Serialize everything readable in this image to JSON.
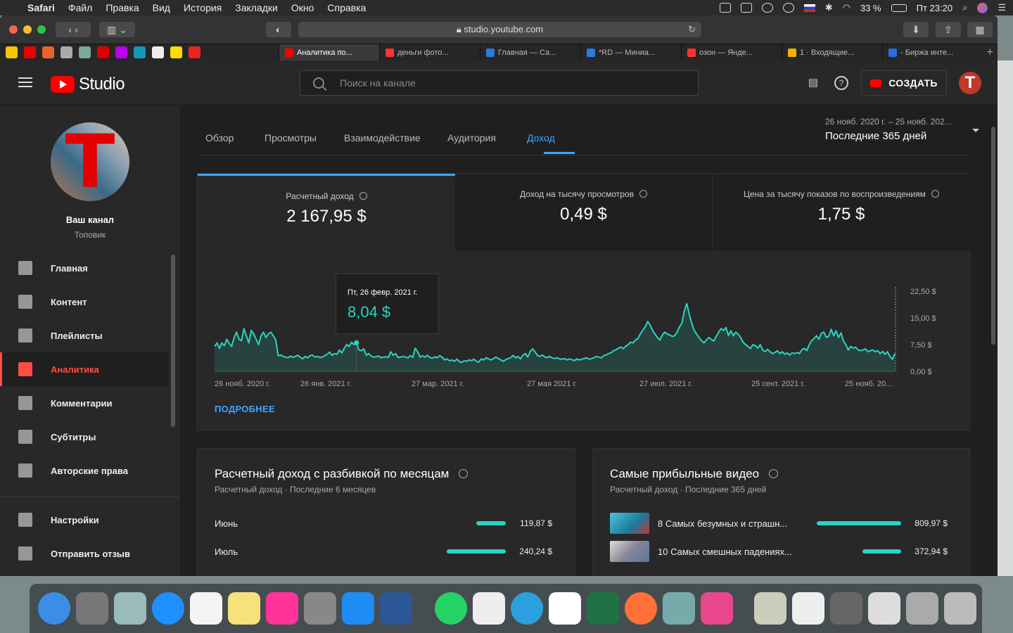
{
  "menubar": {
    "app": "Safari",
    "items": [
      "Файл",
      "Правка",
      "Вид",
      "История",
      "Закладки",
      "Окно",
      "Справка"
    ],
    "battery": "33 %",
    "time": "Пт 23:20"
  },
  "browser": {
    "url": "studio.youtube.com",
    "tabs": [
      {
        "label": "Аналитика по...",
        "color": "#ff0000",
        "active": true
      },
      {
        "label": "деньги фото...",
        "color": "#ff3333"
      },
      {
        "label": "Главная — Са...",
        "color": "#2a7be4"
      },
      {
        "label": "*RD — Миниа...",
        "color": "#2a7be4"
      },
      {
        "label": "озон — Янде...",
        "color": "#ff3333"
      },
      {
        "label": "1 · Входящие...",
        "color": "#f0b400"
      },
      {
        "label": "- Биржа инте...",
        "color": "#2d6cdf"
      }
    ]
  },
  "studio": {
    "logo": "Studio",
    "search_placeholder": "Поиск на канале",
    "create": "СОЗДАТЬ"
  },
  "channel": {
    "name": "Ваш канал",
    "sub": "Топовик",
    "avatar_letter": "T"
  },
  "nav": [
    {
      "label": "Главная",
      "icon": "dashboard-icon"
    },
    {
      "label": "Контент",
      "icon": "video-library-icon"
    },
    {
      "label": "Плейлисты",
      "icon": "playlist-icon"
    },
    {
      "label": "Аналитика",
      "icon": "analytics-icon",
      "active": true
    },
    {
      "label": "Комментарии",
      "icon": "comments-icon"
    },
    {
      "label": "Субтитры",
      "icon": "subtitles-icon"
    },
    {
      "label": "Авторские права",
      "icon": "copyright-icon"
    }
  ],
  "nav_bottom": [
    {
      "label": "Настройки",
      "icon": "settings-icon"
    },
    {
      "label": "Отправить отзыв",
      "icon": "feedback-icon"
    }
  ],
  "tabs": [
    "Обзор",
    "Просмотры",
    "Взаимодействие",
    "Аудитория",
    "Доход"
  ],
  "date": {
    "range": "26 нояб. 2020 г. – 25 нояб. 202...",
    "label": "Последние 365 дней"
  },
  "metrics": [
    {
      "label": "Расчетный доход",
      "value": "2 167,95 $"
    },
    {
      "label": "Доход на тысячу просмотров",
      "value": "0,49 $"
    },
    {
      "label": "Цена за тысячу показов по воспроизведениям",
      "value": "1,75 $"
    }
  ],
  "tooltip": {
    "date": "Пт, 26 февр. 2021 г.",
    "value": "8,04 $"
  },
  "more": "ПОДРОБНЕЕ",
  "chart_data": {
    "type": "area",
    "x_ticks": [
      "26 нояб. 2020 г.",
      "26 янв. 2021 г.",
      "27 мар. 2021 г.",
      "27 мая 2021 г.",
      "27 июл. 2021 г.",
      "25 сент. 2021 г.",
      "25 нояб. 20..."
    ],
    "y_ticks": [
      "0,00 $",
      "7,50 $",
      "15,00 $",
      "22,50 $"
    ],
    "ylim": [
      0,
      22.5
    ],
    "color": "#2bd4c1",
    "values": [
      7,
      8,
      6.5,
      8,
      7.2,
      9,
      7.8,
      7,
      9.5,
      11,
      9,
      8.6,
      12,
      10,
      8,
      11.5,
      10.5,
      9,
      7.5,
      10,
      11,
      9.5,
      10.5,
      11,
      10,
      8.8,
      4.4,
      4.6,
      4.2,
      4,
      3.8,
      4.3,
      3.9,
      4.2,
      4.5,
      4,
      3.5,
      4.2,
      3.8,
      4.4,
      4.6,
      4,
      4.2,
      3.9,
      4,
      4.4,
      4.8,
      5.4,
      4.5,
      5,
      4.8,
      6,
      5.2,
      6.5,
      7.5,
      7,
      8.2,
      7.5,
      8.04,
      6,
      5.8,
      6.3,
      4.5,
      5,
      4.3,
      4,
      4.1,
      4.3,
      3.8,
      4,
      4.1,
      3.9,
      5.5,
      4.5,
      5,
      3.9,
      4,
      4.2,
      4,
      3.8,
      4.4,
      3.9,
      6.5,
      5.5,
      4,
      4.4,
      4,
      4.5,
      3.9,
      3.7,
      4.1,
      3.8,
      4.4,
      4,
      3.2,
      3.5,
      3,
      3.2,
      2.8,
      3.4,
      2.8,
      2.5,
      3,
      2.8,
      3.2,
      3,
      3.4,
      2.8,
      2.6,
      3.5,
      3.2,
      3.8,
      3.5,
      3.2,
      3.6,
      4,
      3.6,
      3.2,
      2.8,
      3.3,
      3.6,
      3.8,
      4.5,
      3.8,
      4.2,
      3.5,
      4.5,
      5,
      4,
      5.6,
      6.3,
      5.4,
      4.4,
      4.2,
      4.6,
      4,
      3.9,
      4.2,
      3.8,
      3.6,
      3.8,
      3.5,
      3.4,
      3.6,
      3.2,
      3.5,
      3.3,
      3,
      3.5,
      3.2,
      3.4,
      3.6,
      3.8,
      3.4,
      3.6,
      3.8,
      4.2,
      4,
      3.8,
      4.4,
      4.6,
      5,
      5.2,
      5.8,
      6,
      6.5,
      6.8,
      6.4,
      7,
      7.5,
      8.2,
      8,
      8.8,
      9.2,
      10.5,
      11.5,
      12.5,
      14,
      13,
      11.5,
      10.5,
      9.5,
      8.8,
      10.2,
      11,
      10.5,
      10.2,
      9.8,
      10,
      11,
      12.5,
      13.5,
      17,
      19,
      16,
      13.5,
      11.5,
      10.5,
      9.5,
      8.6,
      8,
      8.8,
      9.5,
      9,
      8.5,
      9.8,
      11,
      12,
      11.5,
      12.3,
      10,
      11.4,
      10,
      11,
      10.4,
      9.5,
      8.2,
      7.5,
      7,
      6.4,
      7.5,
      7.2,
      6.5,
      7.5,
      6,
      5.5,
      6.2,
      5.5,
      5,
      5.3,
      5.8,
      5,
      5.5,
      4.8,
      5.2,
      4.6,
      5.2,
      5,
      5.3,
      5,
      6,
      6.5,
      5.8,
      7.5,
      8.6,
      9.2,
      10,
      9,
      10.7,
      11,
      9.5,
      9.8,
      11.8,
      10,
      11.4,
      9.5,
      10.8,
      8.5,
      7.5,
      6,
      7,
      6.5,
      6.8,
      6,
      5.8,
      6,
      6.3,
      5.5,
      5.8,
      6,
      5.5,
      5.8,
      5,
      5.6,
      4.8,
      5.5,
      4.2,
      3.4,
      5
    ]
  },
  "monthly": {
    "title": "Расчетный доход с разбивкой по месяцам",
    "sub": "Расчетный доход · Последние 6 месяцев",
    "rows": [
      {
        "label": "Июнь",
        "value": "119,87 $",
        "amount": 119.87
      },
      {
        "label": "Июль",
        "value": "240,24 $",
        "amount": 240.24
      }
    ]
  },
  "top": {
    "title": "Самые прибыльные видео",
    "sub": "Расчетный доход · Последние 365 дней",
    "rows": [
      {
        "label": "8 Самых безумных и страшн...",
        "value": "809,97 $",
        "amount": 809.97
      },
      {
        "label": "10 Самых смешных падениях...",
        "value": "372,94 $",
        "amount": 372.94
      }
    ]
  }
}
